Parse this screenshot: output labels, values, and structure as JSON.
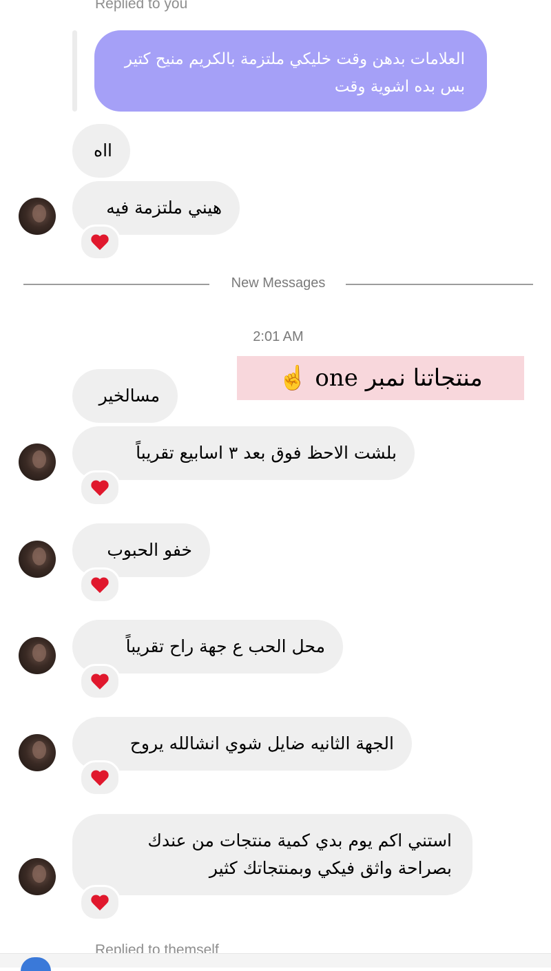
{
  "thread": {
    "replied_label_top": "Replied to you",
    "quoted_message": "العلامات بدهن وقت خليكي ملتزمة بالكريم منيح كتير بس بده اشوية وقت",
    "divider_label": "New Messages",
    "timestamp": "2:01 AM",
    "replied_label_bottom": "Replied to themself"
  },
  "overlay": {
    "text": "منتجاتنا نمبر one",
    "emoji": "☝️"
  },
  "messages": [
    {
      "text": "ااه"
    },
    {
      "text": "هيني ملتزمة فيه",
      "reaction": "heart"
    },
    {
      "text": "مسالخير"
    },
    {
      "text": "بلشت الاحظ فوق بعد ٣ اسابيع تقريباً",
      "reaction": "heart"
    },
    {
      "text": "خفو الحبوب",
      "reaction": "heart"
    },
    {
      "text": "محل الحب ع جهة راح تقريباً",
      "reaction": "heart"
    },
    {
      "text": "الجهة الثانيه ضايل شوي انشالله يروح",
      "reaction": "heart"
    },
    {
      "line1": "استني اكم يوم بدي كمية منتجات من عندك",
      "line2": "بصراحة واثق فيكي وبمنتجاتك كثير",
      "reaction": "heart"
    }
  ],
  "colors": {
    "quoted_bubble": "#a5a0f7",
    "incoming_bubble": "#efefef",
    "overlay_bg": "#f8d7dc",
    "heart": "#e0182d"
  }
}
